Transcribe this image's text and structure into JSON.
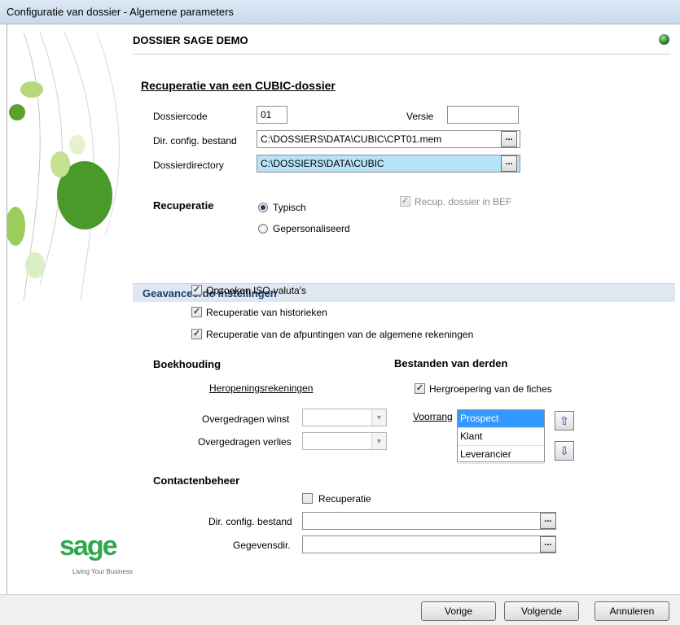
{
  "window": {
    "title": "Configuratie van dossier - Algemene parameters"
  },
  "header": {
    "dossier": "DOSSIER SAGE DEMO"
  },
  "page": {
    "title": "Recuperatie van een CUBIC-dossier"
  },
  "form": {
    "dossiercode_label": "Dossiercode",
    "dossiercode_value": "01",
    "versie_label": "Versie",
    "versie_value": "",
    "config_label": "Dir. config. bestand",
    "config_value": "C:\\DOSSIERS\\DATA\\CUBIC\\CPT01.mem",
    "dossierdir_label": "Dossierdirectory",
    "dossierdir_value": "C:\\DOSSIERS\\DATA\\CUBIC",
    "browse_label": "..."
  },
  "recuperatie": {
    "label": "Recuperatie",
    "typisch": "Typisch",
    "gepersonaliseerd": "Gepersonaliseerd",
    "selected": "Typisch",
    "bef_label": "Recup. dossier in BEF",
    "bef_checked": true
  },
  "advanced": {
    "title": "Geavanceerde instellingen",
    "options": [
      {
        "label": "Opzoeken ISO-valuta's",
        "checked": true
      },
      {
        "label": "Recuperatie van historieken",
        "checked": true
      },
      {
        "label": "Recuperatie van de afpuntingen van de algemene rekeningen",
        "checked": true
      }
    ]
  },
  "boekhouding": {
    "title": "Boekhouding",
    "heropening": "Heropeningsrekeningen",
    "winst_label": "Overgedragen winst",
    "verlies_label": "Overgedragen verlies"
  },
  "derden": {
    "title": "Bestanden van derden",
    "hergroepering": "Hergroepering van de fiches",
    "hergroepering_checked": true,
    "voorrang": "Voorrang",
    "items": [
      "Prospect",
      "Klant",
      "Leverancier"
    ],
    "selected": "Prospect"
  },
  "contact": {
    "title": "Contactenbeheer",
    "recuperatie": "Recuperatie",
    "recuperatie_checked": false,
    "config_label": "Dir. config. bestand",
    "gegevens_label": "Gegevensdir."
  },
  "brand": {
    "logo": "sage",
    "tagline": "Living Your Business"
  },
  "footer": {
    "vorige": "Vorige",
    "volgende": "Volgende",
    "annuleren": "Annuleren"
  },
  "colors": {
    "selection": "#b6e4f5",
    "list_selection": "#3399ff",
    "section_bg": "#dfe8f2",
    "sage_green": "#2fa84f"
  }
}
